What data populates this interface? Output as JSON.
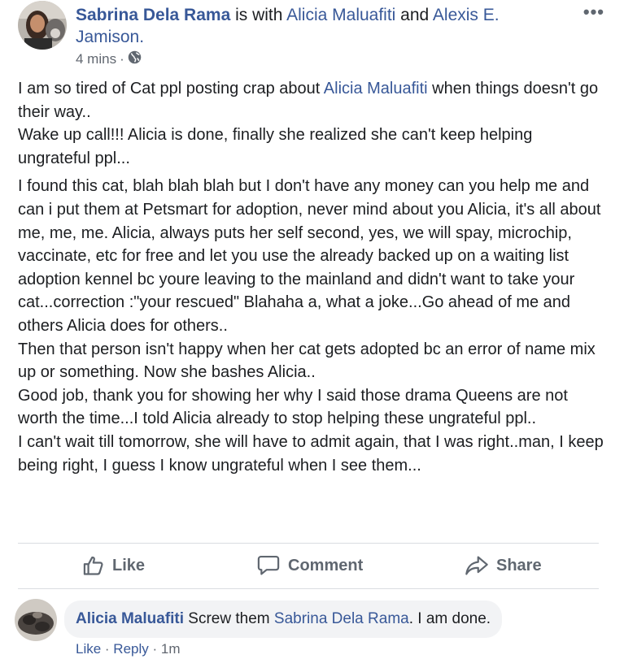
{
  "post": {
    "author": "Sabrina Dela Rama",
    "with_text": " is with ",
    "tagged_1": "Alicia Maluafiti",
    "and_text": " and ",
    "tagged_2": "Alexis E. Jamison.",
    "time": "4 mins",
    "separator": "·",
    "more_icon_glyph": "•••",
    "more_icon": "more-options-icon",
    "audience_icon": "globe-icon",
    "paragraphs": {
      "p1_a": "I am so tired of Cat ppl posting crap about ",
      "p1_link": "Alicia Maluafiti",
      "p1_b": " when things doesn't go their way..",
      "p1_c": "Wake up call!!! Alicia is done, finally she realized she can't keep helping ungrateful ppl...",
      "p2": "I found this cat, blah blah blah but I don't have any money can you help me and can i put them at Petsmart for adoption, never mind about you Alicia, it's all about me, me, me. Alicia, always puts her self second, yes, we will spay, microchip, vaccinate, etc for free and let you use the already backed up on a waiting list adoption kennel bc youre leaving to the mainland and didn't want to take your cat...correction :\"your rescued\" Blahaha a, what a joke...Go ahead of me and others Alicia does for others..",
      "p3": "Then that person isn't happy when her cat gets adopted bc an error of name mix up or something. Now she bashes Alicia..",
      "p4": "Good job, thank you for showing her why I said those drama Queens are not worth the time...I told Alicia already to stop helping these ungrateful ppl..",
      "p5": "I can't wait till tomorrow, she will have to admit again, that I was right..man, I keep being right, I guess I know ungrateful when I see them..."
    }
  },
  "actions": {
    "like": "Like",
    "comment": "Comment",
    "share": "Share"
  },
  "comment": {
    "author": "Alicia Maluafiti",
    "text_a": " Screw them ",
    "mention": "Sabrina Dela Rama",
    "text_b": ". I am done.",
    "like": "Like",
    "dot1": " · ",
    "reply": "Reply",
    "dot2": " · ",
    "time": "1m"
  },
  "colors": {
    "link": "#385898",
    "meta": "#616770",
    "bubble": "#f2f3f5",
    "divider": "#dadde1"
  }
}
